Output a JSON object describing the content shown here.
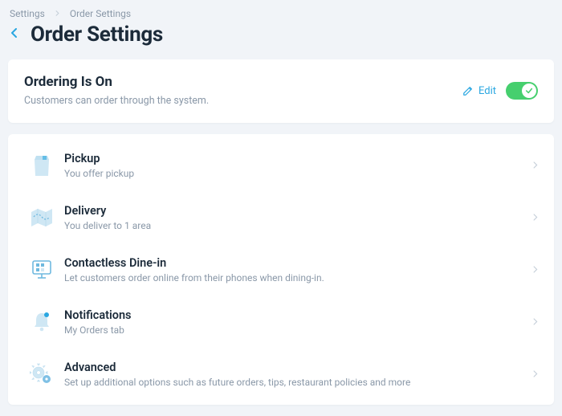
{
  "breadcrumb": {
    "root": "Settings",
    "current": "Order Settings"
  },
  "page": {
    "title": "Order Settings"
  },
  "ordering": {
    "heading": "Ordering Is On",
    "subtext": "Customers can order through the system.",
    "edit_label": "Edit",
    "toggle_on": true
  },
  "options": [
    {
      "icon": "bag-icon",
      "title": "Pickup",
      "sub": "You offer pickup"
    },
    {
      "icon": "map-icon",
      "title": "Delivery",
      "sub": "You deliver to 1 area"
    },
    {
      "icon": "screen-icon",
      "title": "Contactless Dine-in",
      "sub": "Let customers order online from their phones when dining-in."
    },
    {
      "icon": "bell-icon",
      "title": "Notifications",
      "sub": "My Orders tab"
    },
    {
      "icon": "gears-icon",
      "title": "Advanced",
      "sub": "Set up additional options such as future orders, tips, restaurant policies and more"
    }
  ],
  "colors": {
    "accent": "#2aa7e1",
    "iconFill": "#cfe7f4",
    "iconStroke": "#6fb9df",
    "toggle": "#46cf6e"
  }
}
